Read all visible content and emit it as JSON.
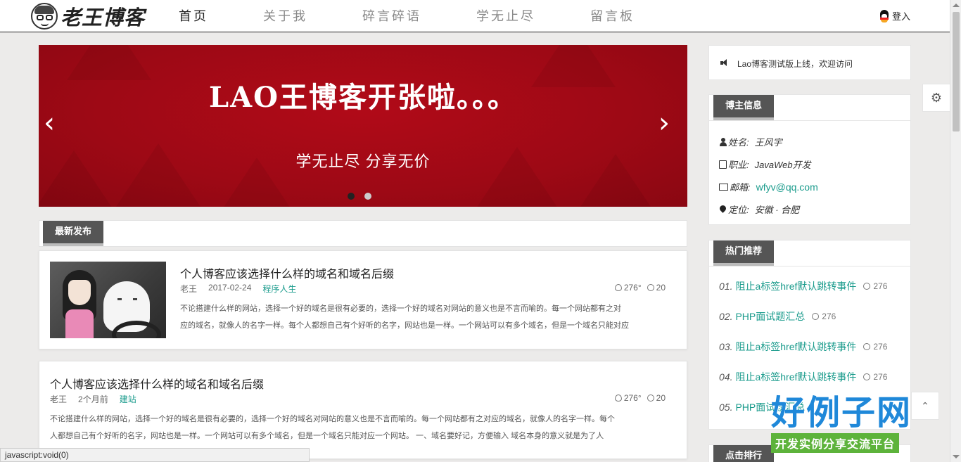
{
  "header": {
    "logo_text": "老王博客",
    "nav": [
      {
        "label": "首页",
        "active": true
      },
      {
        "label": "关于我",
        "active": false
      },
      {
        "label": "碎言碎语",
        "active": false
      },
      {
        "label": "学无止尽",
        "active": false
      },
      {
        "label": "留言板",
        "active": false
      }
    ],
    "login_label": "登入"
  },
  "banner": {
    "title": "LAO王博客开张啦。。。",
    "subtitle": "学无止尽 分享无价",
    "prev_label": "‹",
    "next_label": "›",
    "slide_count": 2,
    "active_slide": 1,
    "color": "#a80a16"
  },
  "latest": {
    "heading": "最新发布",
    "articles": [
      {
        "title": "个人博客应该选择什么样的域名和域名后缀",
        "author": "老王",
        "date": "2017-02-24",
        "category": "程序人生",
        "views": "276°",
        "comments": "20",
        "excerpt_line1": "不论搭建什么样的网站，选择一个好的域名是很有必要的，选择一个好的域名对网站的意义也是不言而喻的。每一个网站都有之对",
        "excerpt_line2": "应的域名，就像人的名字一样。每个人都想自己有个好听的名字，网站也是一样。一个网站可以有多个域名，但是一个域名只能对应"
      },
      {
        "title": "个人博客应该选择什么样的域名和域名后缀",
        "author": "老王",
        "date": "2个月前",
        "category": "建站",
        "views": "276°",
        "comments": "20",
        "excerpt_line1": "不论搭建什么样的网站，选择一个好的域名是很有必要的，选择一个好的域名对网站的意义也是不言而喻的。每一个网站都有之对应的域名，就像人的名字一样。每个",
        "excerpt_line2": "人都想自己有个好听的名字，网站也是一样。一个网站可以有多个域名，但是一个域名只能对应一个网站。 一、域名要好记，方便输入       域名本身的意义就是为了人"
      }
    ]
  },
  "sidebar": {
    "notice": "Lao博客测试版上线，欢迎访问",
    "blogger": {
      "heading": "博主信息",
      "rows": [
        {
          "icon": "user-icon",
          "label": "姓名:",
          "value": "王风宇"
        },
        {
          "icon": "briefcase-icon",
          "label": "职业:",
          "value": "JavaWeb开发"
        },
        {
          "icon": "mail-icon",
          "label": "邮箱:",
          "value": "wfyv@qq.com"
        },
        {
          "icon": "location-icon",
          "label": "定位:",
          "value": "安徽 · 合肥"
        }
      ]
    },
    "hot": {
      "heading": "热门推荐",
      "items": [
        {
          "num": "01.",
          "title": "阻止a标签href默认跳转事件",
          "count": "276"
        },
        {
          "num": "02.",
          "title": "PHP面试题汇总",
          "count": "276"
        },
        {
          "num": "03.",
          "title": "阻止a标签href默认跳转事件",
          "count": "276"
        },
        {
          "num": "04.",
          "title": "阻止a标签href默认跳转事件",
          "count": "276"
        },
        {
          "num": "05.",
          "title": "PHP面试题汇总",
          "count": ""
        }
      ]
    },
    "rank_heading": "点击排行"
  },
  "status_bar": "javascript:void(0)",
  "watermark": {
    "main": "好例子网",
    "sub": "开发实例分享交流平台"
  },
  "colors": {
    "accent": "#1a9b8c",
    "banner": "#a80a16",
    "tab_head": "#555555"
  }
}
